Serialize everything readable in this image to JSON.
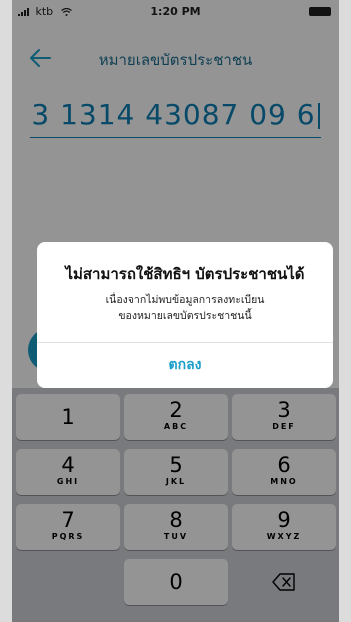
{
  "status_bar": {
    "carrier": "ktb",
    "time": "1:20 PM"
  },
  "header": {
    "title": "หมายเลขบัตรประชาชน"
  },
  "id_input": {
    "value": "3 1314 43087 09 6"
  },
  "keypad": {
    "keys": [
      {
        "num": "1",
        "letters": ""
      },
      {
        "num": "2",
        "letters": "ABC"
      },
      {
        "num": "3",
        "letters": "DEF"
      },
      {
        "num": "4",
        "letters": "GHI"
      },
      {
        "num": "5",
        "letters": "JKL"
      },
      {
        "num": "6",
        "letters": "MNO"
      },
      {
        "num": "7",
        "letters": "PQRS"
      },
      {
        "num": "8",
        "letters": "TUV"
      },
      {
        "num": "9",
        "letters": "WXYZ"
      },
      {
        "num": "0",
        "letters": ""
      }
    ]
  },
  "dialog": {
    "title": "ไม่สามารถใช้สิทธิฯ บัตรประชาชนได้",
    "message_line1": "เนื่องจากไม่พบข้อมูลการลงทะเบียน",
    "message_line2": "ของหมายเลขบัตรประชาชนนี้",
    "ok_label": "ตกลง"
  },
  "colors": {
    "accent": "#1b9fc9",
    "title_blue": "#1c6e90",
    "input_blue": "#0b7fb3"
  }
}
